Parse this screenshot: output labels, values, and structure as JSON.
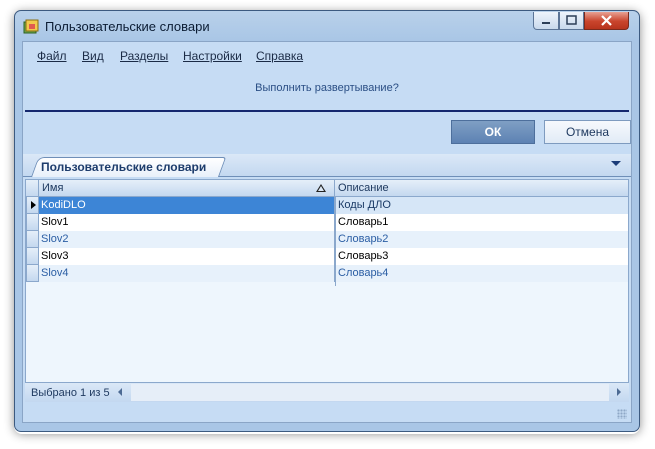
{
  "window": {
    "title": "Пользовательские словари"
  },
  "menu": {
    "items": [
      "Файл",
      "Вид",
      "Разделы",
      "Настройки",
      "Справка"
    ]
  },
  "prompt": {
    "text": "Выполнить развертывание?"
  },
  "buttons": {
    "ok": "ОК",
    "cancel": "Отмена"
  },
  "panel": {
    "tab_label": "Пользовательские словари"
  },
  "grid": {
    "columns": [
      "Имя",
      "Описание"
    ],
    "rows": [
      {
        "name": "KodiDLO",
        "description": "Коды ДЛО"
      },
      {
        "name": "Slov1",
        "description": "Словарь1"
      },
      {
        "name": "Slov2",
        "description": "Словарь2"
      },
      {
        "name": "Slov3",
        "description": "Словарь3"
      },
      {
        "name": "Slov4",
        "description": "Словарь4"
      }
    ]
  },
  "status": {
    "text": "Выбрано 1 из 5"
  },
  "colors": {
    "selection": "#3d85d6",
    "ok_button": "#6f90bc",
    "separator": "#15286e"
  }
}
